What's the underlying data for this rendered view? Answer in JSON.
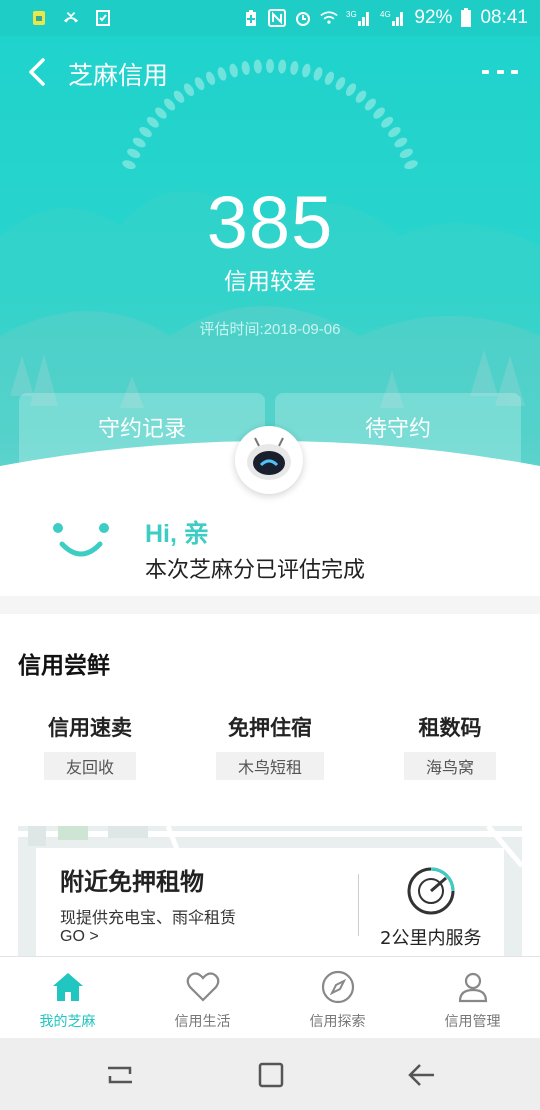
{
  "status_bar": {
    "battery": "92%",
    "time": "08:41",
    "icons": [
      "sim-icon",
      "missed-call-icon",
      "task-icon",
      "battery-saver-icon",
      "nfc-icon",
      "alarm-icon",
      "wifi-icon",
      "signal-3g-icon",
      "signal-4g-icon",
      "battery-icon"
    ],
    "network_3g": "3G",
    "network_4g": "4G"
  },
  "header": {
    "title": "芝麻信用",
    "back_icon": "chevron-left-icon",
    "more_icon": "more-dots-icon"
  },
  "score_panel": {
    "score": "385",
    "level": "信用较差",
    "eval_time": "评估时间:2018-09-06"
  },
  "tabs": {
    "left": "守约记录",
    "right": "待守约"
  },
  "greeting": {
    "hi": "Hi, 亲",
    "message": "本次芝麻分已评估完成"
  },
  "credit_trial": {
    "title": "信用尝鲜",
    "items": [
      {
        "name": "信用速卖",
        "tag": "友回收"
      },
      {
        "name": "免押住宿",
        "tag": "木鸟短租"
      },
      {
        "name": "租数码",
        "tag": "海鸟窝"
      }
    ]
  },
  "nearby": {
    "title": "附近免押租物",
    "desc": "现提供充电宝、雨伞租赁",
    "go": "GO >",
    "range": "2公里内服务"
  },
  "tab_bar": {
    "items": [
      {
        "label": "我的芝麻",
        "icon": "home-icon",
        "active": true
      },
      {
        "label": "信用生活",
        "icon": "heart-icon",
        "active": false
      },
      {
        "label": "信用探索",
        "icon": "compass-icon",
        "active": false
      },
      {
        "label": "信用管理",
        "icon": "user-icon",
        "active": false
      }
    ]
  },
  "colors": {
    "accent": "#1ecdc6",
    "active_tab": "#20c6bf"
  }
}
